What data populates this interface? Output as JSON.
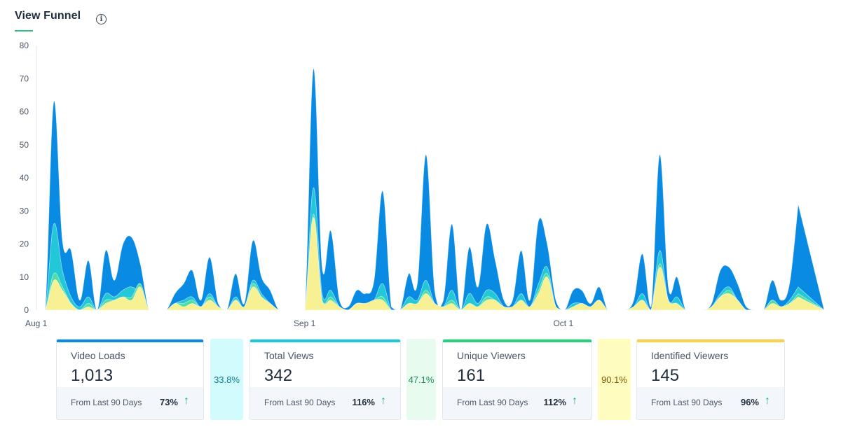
{
  "header": {
    "title": "View Funnel",
    "info_icon": "info-icon"
  },
  "colors": {
    "video_loads": "#0a8be3",
    "total_views": "#22c7d8",
    "unique_viewers": "#4fdca6",
    "identified_viewers": "#f7f193",
    "rate_cyan_bg": "#d2fbfd",
    "rate_green_bg": "#e7fbef",
    "rate_yellow_bg": "#fefcbf"
  },
  "chart_data": {
    "type": "area",
    "ylim": [
      0,
      80
    ],
    "yticks": [
      "0",
      "10",
      "20",
      "30",
      "40",
      "50",
      "60",
      "70",
      "80"
    ],
    "x_tick_labels": [
      {
        "label": "Aug 1",
        "index": 0
      },
      {
        "label": "Sep 1",
        "index": 31
      },
      {
        "label": "Oct 1",
        "index": 61
      }
    ],
    "x_count": 92,
    "series": [
      {
        "key": "video_loads",
        "values": [
          0,
          0,
          63,
          21,
          18,
          3,
          15,
          0,
          18,
          9,
          20,
          22,
          14,
          0,
          0,
          0,
          5,
          8,
          12,
          3,
          16,
          2,
          0,
          11,
          2,
          21,
          10,
          6,
          0,
          0,
          0,
          0,
          73,
          13,
          24,
          3,
          1,
          6,
          5,
          9,
          36,
          1,
          0,
          11,
          8,
          47,
          6,
          3,
          26,
          0,
          19,
          7,
          26,
          15,
          3,
          3,
          18,
          3,
          27,
          20,
          3,
          0,
          6,
          6,
          2,
          7,
          0,
          0,
          0,
          3,
          17,
          1,
          47,
          7,
          10,
          0,
          0,
          0,
          2,
          12,
          13,
          8,
          1,
          0,
          0,
          9,
          3,
          8,
          32
        ]
      },
      {
        "key": "total_views",
        "values": [
          0,
          0,
          26,
          12,
          4,
          1,
          4,
          0,
          5,
          4,
          6,
          7,
          5,
          0,
          0,
          0,
          2,
          3,
          4,
          1,
          5,
          1,
          0,
          4,
          1,
          9,
          5,
          2,
          0,
          0,
          0,
          0,
          37,
          5,
          6,
          1,
          0,
          2,
          2,
          3,
          8,
          0,
          0,
          4,
          3,
          9,
          2,
          1,
          6,
          0,
          5,
          2,
          6,
          5,
          1,
          1,
          5,
          1,
          8,
          13,
          1,
          0,
          2,
          2,
          1,
          3,
          0,
          0,
          0,
          1,
          5,
          0,
          18,
          3,
          4,
          0,
          0,
          0,
          1,
          5,
          7,
          3,
          0,
          0,
          0,
          3,
          1,
          3,
          7
        ]
      },
      {
        "key": "unique_viewers",
        "values": [
          0,
          0,
          11,
          7,
          2,
          0,
          2,
          0,
          3,
          3,
          4,
          4,
          8,
          0,
          0,
          0,
          2,
          2,
          3,
          1,
          4,
          1,
          0,
          3,
          1,
          8,
          4,
          2,
          0,
          0,
          0,
          0,
          29,
          3,
          4,
          1,
          0,
          2,
          2,
          3,
          4,
          0,
          0,
          2,
          2,
          6,
          2,
          1,
          3,
          0,
          2,
          1,
          4,
          3,
          1,
          1,
          3,
          1,
          6,
          11,
          1,
          0,
          1,
          2,
          1,
          3,
          0,
          0,
          0,
          1,
          3,
          0,
          14,
          3,
          2,
          0,
          0,
          0,
          1,
          4,
          6,
          3,
          0,
          0,
          0,
          3,
          1,
          2,
          5
        ]
      },
      {
        "key": "identified_viewers",
        "values": [
          0,
          0,
          9,
          6,
          2,
          0,
          1,
          0,
          2,
          3,
          4,
          3,
          7,
          0,
          0,
          0,
          2,
          1,
          2,
          1,
          3,
          1,
          0,
          3,
          1,
          7,
          4,
          2,
          0,
          0,
          0,
          0,
          28,
          3,
          3,
          1,
          0,
          2,
          2,
          3,
          3,
          0,
          0,
          2,
          2,
          5,
          2,
          1,
          2,
          0,
          2,
          1,
          3,
          3,
          1,
          1,
          3,
          1,
          5,
          10,
          1,
          0,
          1,
          2,
          1,
          3,
          0,
          0,
          0,
          1,
          3,
          0,
          13,
          3,
          2,
          0,
          0,
          0,
          1,
          4,
          5,
          3,
          0,
          0,
          0,
          2,
          1,
          2,
          4
        ]
      }
    ]
  },
  "cards": [
    {
      "label": "Video Loads",
      "value": "1,013",
      "from": "From Last 90 Days",
      "change": "73%"
    },
    {
      "label": "Total Views",
      "value": "342",
      "from": "From Last 90 Days",
      "change": "116%"
    },
    {
      "label": "Unique Viewers",
      "value": "161",
      "from": "From Last 90 Days",
      "change": "112%"
    },
    {
      "label": "Identified Viewers",
      "value": "145",
      "from": "From Last 90 Days",
      "change": "96%"
    }
  ],
  "rates": [
    "33.8%",
    "47.1%",
    "90.1%"
  ],
  "arrow_glyph": "↑"
}
